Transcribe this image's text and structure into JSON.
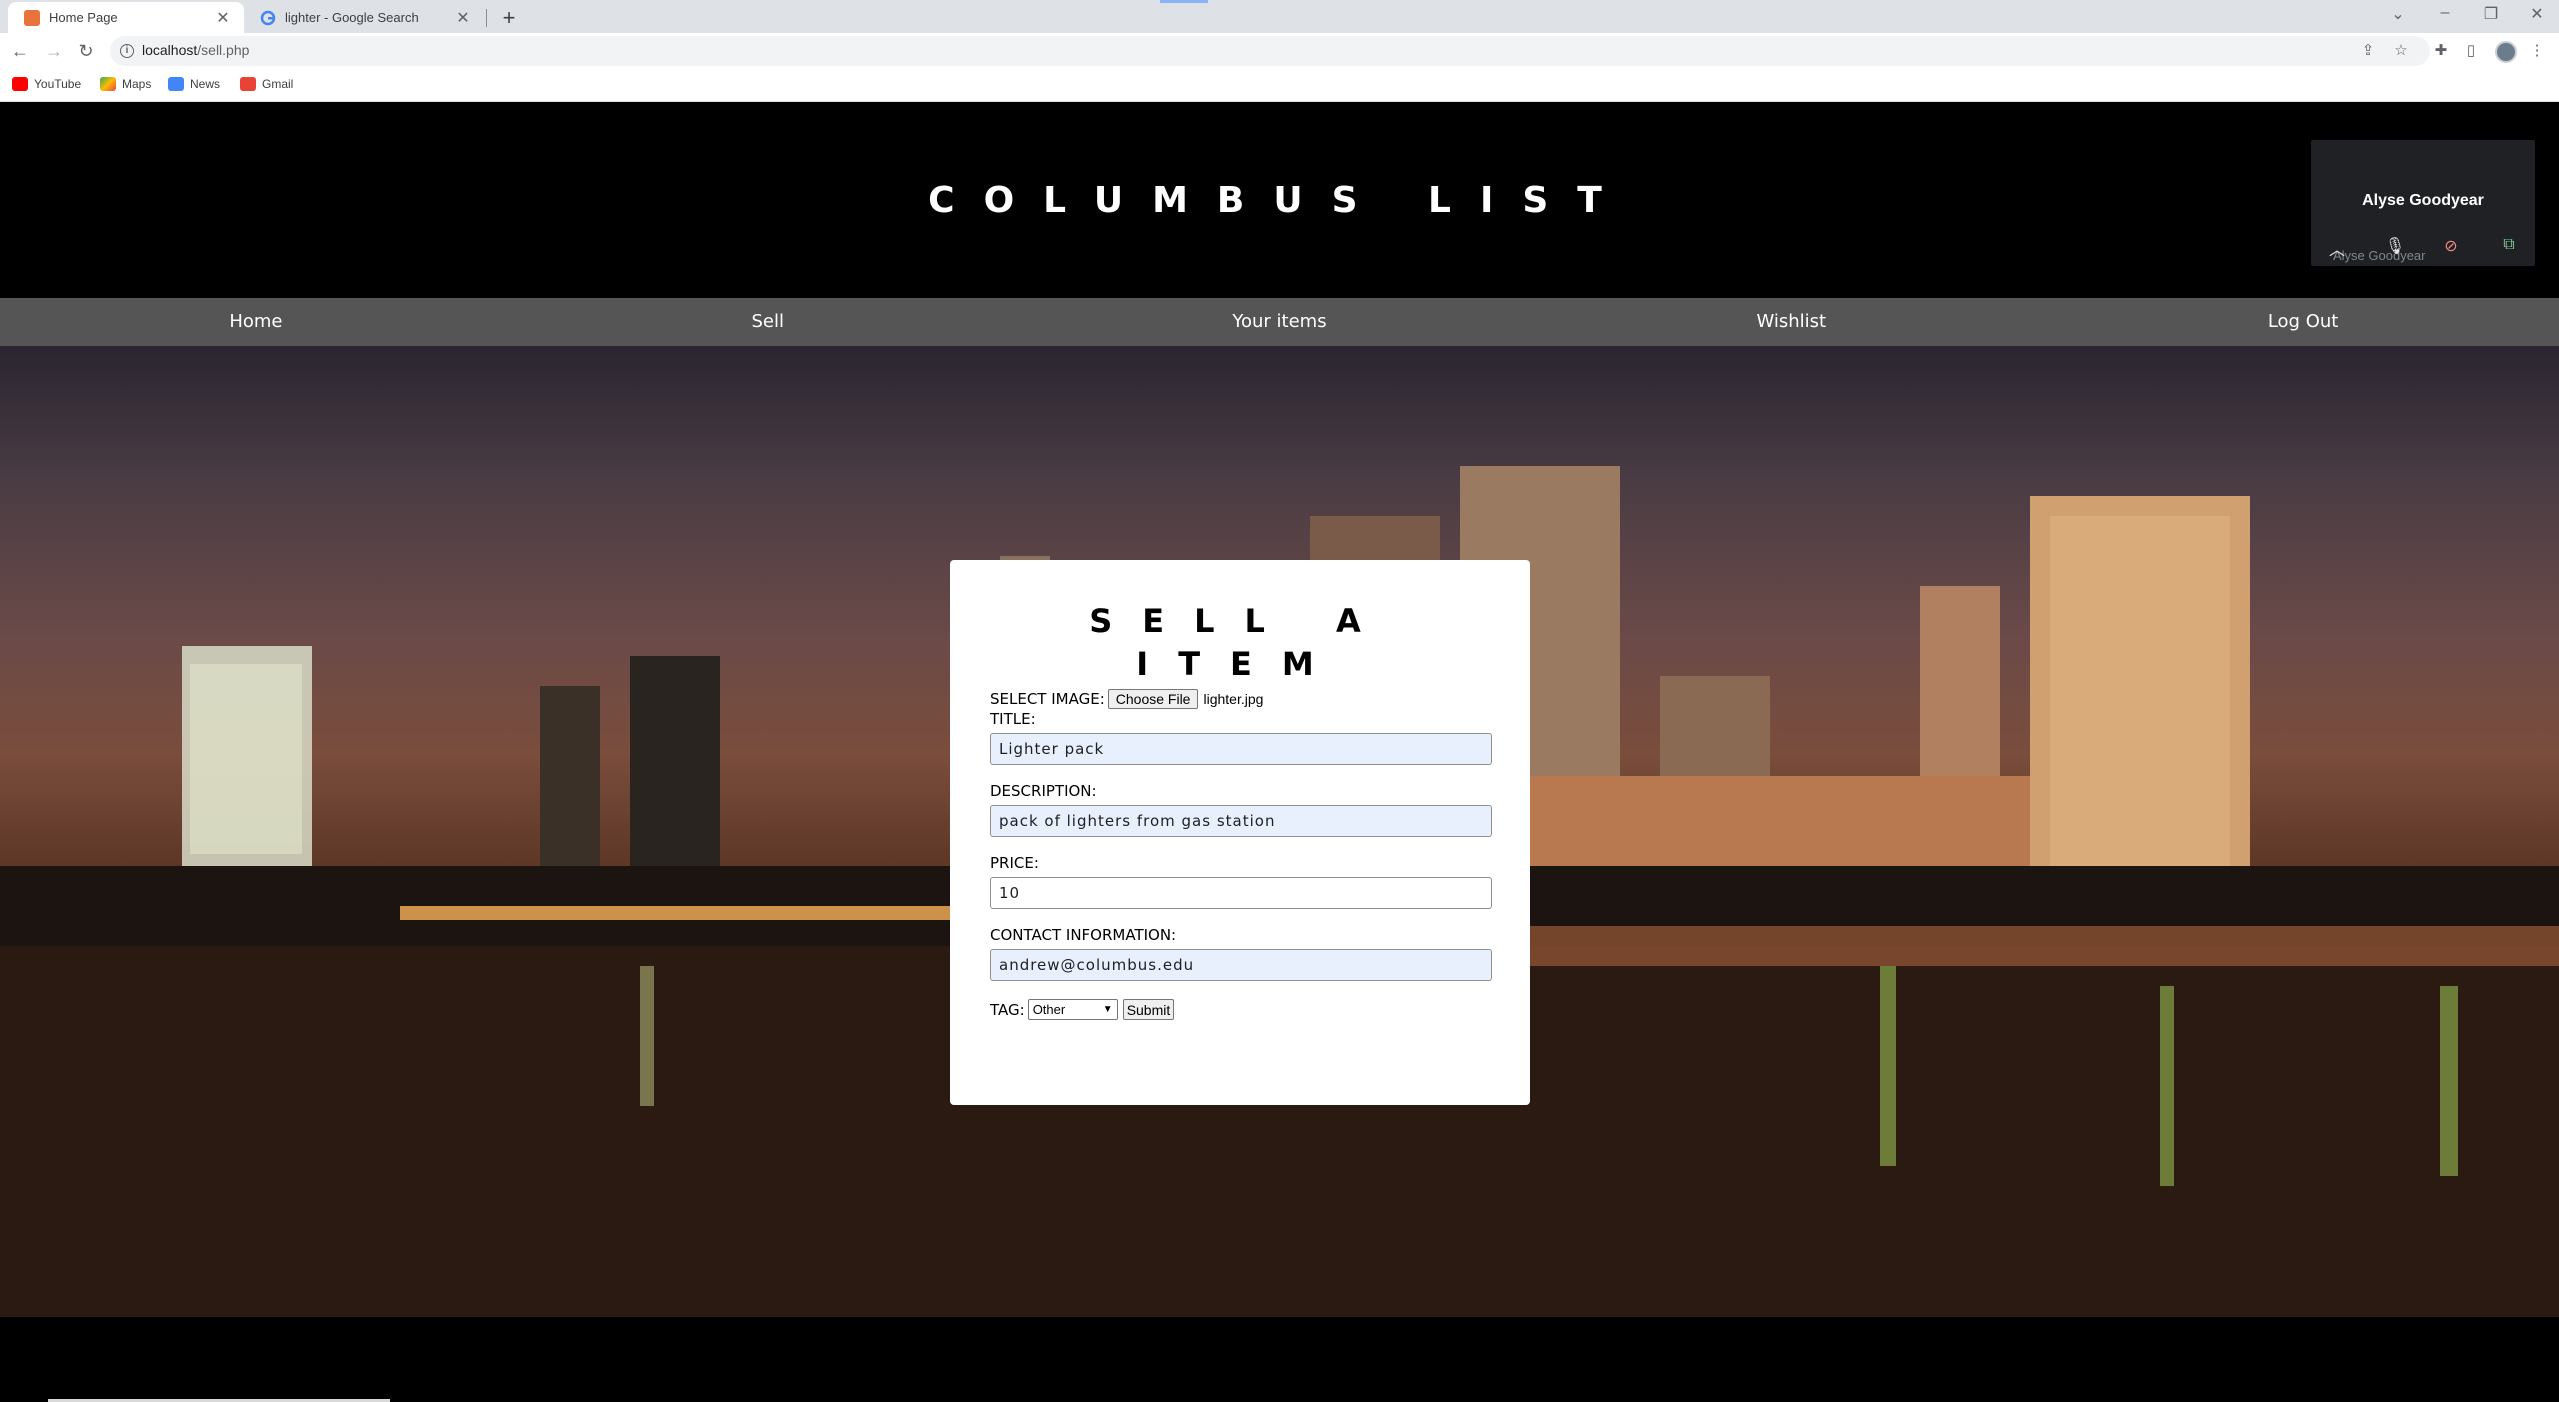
{
  "browser": {
    "tabs": [
      {
        "label": "Home Page",
        "active": true
      },
      {
        "label": "lighter - Google Search",
        "active": false
      }
    ],
    "url_host": "localhost",
    "url_path": "/sell.php",
    "bookmarks": [
      "YouTube",
      "Maps",
      "News",
      "Gmail"
    ]
  },
  "site": {
    "title": "COLUMBUS LIST",
    "nav": [
      "Home",
      "Sell",
      "Your items",
      "Wishlist",
      "Log Out"
    ]
  },
  "meet": {
    "name": "Alyse Goodyear",
    "sub_label": "Alyse Goodyear"
  },
  "form": {
    "title": "SELL A ITEM",
    "select_image_label": "SELECT IMAGE:",
    "choose_file_label": "Choose File",
    "file_name": "lighter.jpg",
    "title_label": "TITLE:",
    "title_value": "Lighter pack",
    "description_label": "DESCRIPTION:",
    "description_value": "pack of lighters from gas station",
    "price_label": "PRICE:",
    "price_value": "10",
    "contact_label": "CONTACT INFORMATION:",
    "contact_value": "andrew@columbus.edu",
    "tag_label": "TAG:",
    "tag_value": "Other",
    "submit_label": "Submit"
  }
}
